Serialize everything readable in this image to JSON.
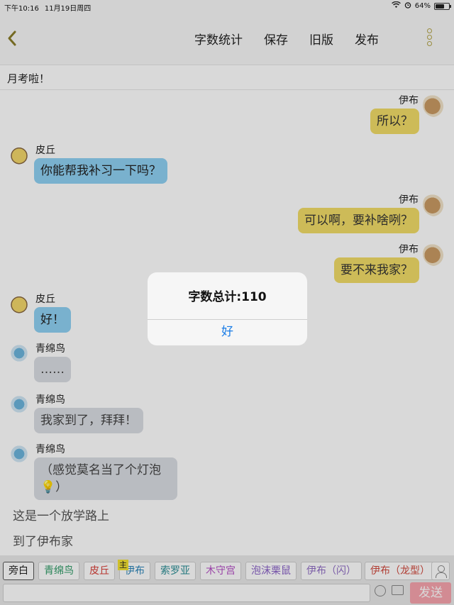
{
  "status": {
    "time": "下午10:16",
    "date": "11月19日周四",
    "battery": "64%",
    "battery_fill": 0.64
  },
  "nav": {
    "back_icon": "chevron-left-icon",
    "actions": [
      "字数统计",
      "保存",
      "旧版",
      "发布"
    ],
    "more_icon": "more-vertical-icon"
  },
  "chat_title": "月考啦！",
  "messages": [
    {
      "sender": "伊布",
      "text": "所以？",
      "side": "right"
    },
    {
      "sender": "皮丘",
      "text": "你能帮我补习一下吗？",
      "side": "left"
    },
    {
      "sender": "伊布",
      "text": "可以啊，要补啥咧？",
      "side": "right"
    },
    {
      "sender": "伊布",
      "text": "要不来我家？",
      "side": "right"
    },
    {
      "sender": "皮丘",
      "text": "好！",
      "side": "left"
    },
    {
      "sender": "青绵鸟",
      "text": "……",
      "side": "left"
    },
    {
      "sender": "青绵鸟",
      "text": "我家到了，拜拜！",
      "side": "left"
    },
    {
      "sender": "青绵鸟",
      "text": "（感觉莫名当了个灯泡💡）",
      "side": "left"
    }
  ],
  "narration": [
    "这是一个放学路上",
    "到了伊布家"
  ],
  "alert": {
    "message": "字数总计:110",
    "ok": "好"
  },
  "characters": [
    "旁白",
    "青绵鸟",
    "皮丘",
    "伊布",
    "索罗亚",
    "木守宫",
    "泡沫栗鼠",
    "伊布（闪）",
    "伊布（龙型）"
  ],
  "host_badge": "主",
  "input": {
    "send": "发送"
  },
  "colors": {
    "yellow_bubble": "#f1dc68",
    "blue_bubble": "#8fd0f2",
    "gray_bubble": "#dadde3",
    "alert_ok": "#1a7ce6",
    "send_button": "#f7a4ad",
    "char_colors": [
      "#222222",
      "#2e9a66",
      "#d9413a",
      "#2a83b8",
      "#2a8d94",
      "#b34cc4",
      "#8a62c7",
      "#8f6bc4",
      "#d0493e"
    ]
  }
}
